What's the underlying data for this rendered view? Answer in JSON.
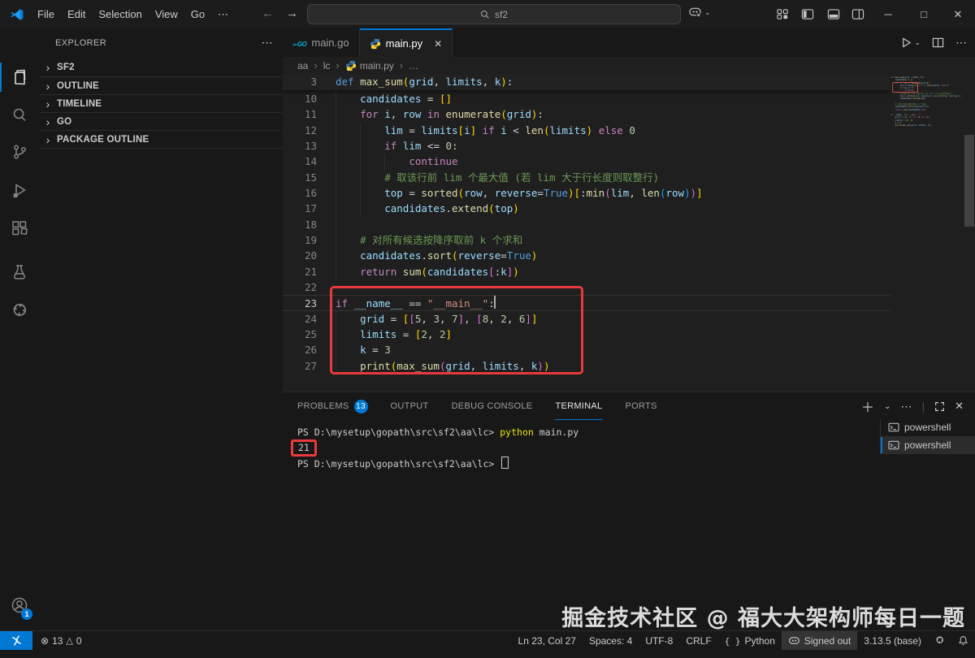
{
  "titlebar": {
    "menus": [
      "File",
      "Edit",
      "Selection",
      "View",
      "Go",
      "⋯"
    ],
    "search_value": "sf2"
  },
  "activity_bar": {
    "items": [
      {
        "name": "explorer",
        "active": true
      },
      {
        "name": "search",
        "active": false
      },
      {
        "name": "source-control",
        "active": false
      },
      {
        "name": "run-debug",
        "active": false
      },
      {
        "name": "extensions",
        "active": false
      },
      {
        "name": "testing",
        "active": false
      },
      {
        "name": "extension-custom",
        "active": false
      }
    ],
    "account_badge": "1"
  },
  "sidebar": {
    "title": "EXPLORER",
    "sections": [
      {
        "label": "SF2"
      },
      {
        "label": "OUTLINE"
      },
      {
        "label": "TIMELINE"
      },
      {
        "label": "GO"
      },
      {
        "label": "PACKAGE OUTLINE"
      }
    ]
  },
  "editor": {
    "tabs": [
      {
        "label": "main.go",
        "icon": "go",
        "active": false
      },
      {
        "label": "main.py",
        "icon": "python",
        "active": true
      }
    ],
    "breadcrumb": [
      {
        "label": "aa"
      },
      {
        "label": "lc"
      },
      {
        "label": "main.py",
        "icon": "python"
      },
      {
        "label": "…"
      }
    ],
    "sticky_line": {
      "number": "3",
      "segments": [
        [
          "def",
          "def"
        ],
        [
          " ",
          "p"
        ],
        [
          "max_sum",
          "fn"
        ],
        [
          "(",
          "b1"
        ],
        [
          "grid",
          "v"
        ],
        [
          ", ",
          "p"
        ],
        [
          "limits",
          "v"
        ],
        [
          ", ",
          "p"
        ],
        [
          "k",
          "v"
        ],
        [
          ")",
          "b1"
        ],
        [
          ":",
          "p"
        ]
      ]
    },
    "lines": [
      {
        "number": "10",
        "guides": [
          0
        ],
        "segments": [
          [
            "    ",
            "p"
          ],
          [
            "candidates",
            "v"
          ],
          [
            " = ",
            "p"
          ],
          [
            "[]",
            "b1"
          ]
        ]
      },
      {
        "number": "11",
        "guides": [
          0
        ],
        "segments": [
          [
            "    ",
            "p"
          ],
          [
            "for",
            "kw"
          ],
          [
            " ",
            "p"
          ],
          [
            "i",
            "v"
          ],
          [
            ", ",
            "p"
          ],
          [
            "row",
            "v"
          ],
          [
            " ",
            "p"
          ],
          [
            "in",
            "kw"
          ],
          [
            " ",
            "p"
          ],
          [
            "enumerate",
            "fn"
          ],
          [
            "(",
            "b1"
          ],
          [
            "grid",
            "v"
          ],
          [
            ")",
            "b1"
          ],
          [
            ":",
            "p"
          ]
        ]
      },
      {
        "number": "12",
        "guides": [
          0,
          4
        ],
        "segments": [
          [
            "        ",
            "p"
          ],
          [
            "lim",
            "v"
          ],
          [
            " = ",
            "p"
          ],
          [
            "limits",
            "v"
          ],
          [
            "[",
            "b1"
          ],
          [
            "i",
            "v"
          ],
          [
            "]",
            "b1"
          ],
          [
            " ",
            "p"
          ],
          [
            "if",
            "kw"
          ],
          [
            " ",
            "p"
          ],
          [
            "i",
            "v"
          ],
          [
            " < ",
            "p"
          ],
          [
            "len",
            "fn"
          ],
          [
            "(",
            "b1"
          ],
          [
            "limits",
            "v"
          ],
          [
            ")",
            "b1"
          ],
          [
            " ",
            "p"
          ],
          [
            "else",
            "kw"
          ],
          [
            " ",
            "p"
          ],
          [
            "0",
            "n"
          ]
        ]
      },
      {
        "number": "13",
        "guides": [
          0,
          4
        ],
        "segments": [
          [
            "        ",
            "p"
          ],
          [
            "if",
            "kw"
          ],
          [
            " ",
            "p"
          ],
          [
            "lim",
            "v"
          ],
          [
            " <= ",
            "p"
          ],
          [
            "0",
            "n"
          ],
          [
            ":",
            "p"
          ]
        ]
      },
      {
        "number": "14",
        "guides": [
          0,
          4,
          8
        ],
        "segments": [
          [
            "            ",
            "p"
          ],
          [
            "continue",
            "kw"
          ]
        ]
      },
      {
        "number": "15",
        "guides": [
          0,
          4
        ],
        "segments": [
          [
            "        ",
            "p"
          ],
          [
            "# 取该行前 lim 个最大值 (若 lim 大于行长度则取整行)",
            "c"
          ]
        ]
      },
      {
        "number": "16",
        "guides": [
          0,
          4
        ],
        "segments": [
          [
            "        ",
            "p"
          ],
          [
            "top",
            "v"
          ],
          [
            " = ",
            "p"
          ],
          [
            "sorted",
            "fn"
          ],
          [
            "(",
            "b1"
          ],
          [
            "row",
            "v"
          ],
          [
            ", ",
            "p"
          ],
          [
            "reverse",
            "v"
          ],
          [
            "=",
            "p"
          ],
          [
            "True",
            "def"
          ],
          [
            ")",
            "b1"
          ],
          [
            "[",
            "b1"
          ],
          [
            ":",
            "p"
          ],
          [
            "min",
            "fn"
          ],
          [
            "(",
            "b2"
          ],
          [
            "lim",
            "v"
          ],
          [
            ", ",
            "p"
          ],
          [
            "len",
            "fn"
          ],
          [
            "(",
            "b3"
          ],
          [
            "row",
            "v"
          ],
          [
            ")",
            "b3"
          ],
          [
            ")",
            "b2"
          ],
          [
            "]",
            "b1"
          ]
        ]
      },
      {
        "number": "17",
        "guides": [
          0,
          4
        ],
        "segments": [
          [
            "        ",
            "p"
          ],
          [
            "candidates",
            "v"
          ],
          [
            ".",
            "p"
          ],
          [
            "extend",
            "fn"
          ],
          [
            "(",
            "b1"
          ],
          [
            "top",
            "v"
          ],
          [
            ")",
            "b1"
          ]
        ]
      },
      {
        "number": "18",
        "guides": [
          0
        ],
        "segments": []
      },
      {
        "number": "19",
        "guides": [
          0
        ],
        "segments": [
          [
            "    ",
            "p"
          ],
          [
            "# 对所有候选按降序取前 k 个求和",
            "c"
          ]
        ]
      },
      {
        "number": "20",
        "guides": [
          0
        ],
        "segments": [
          [
            "    ",
            "p"
          ],
          [
            "candidates",
            "v"
          ],
          [
            ".",
            "p"
          ],
          [
            "sort",
            "fn"
          ],
          [
            "(",
            "b1"
          ],
          [
            "reverse",
            "v"
          ],
          [
            "=",
            "p"
          ],
          [
            "True",
            "def"
          ],
          [
            ")",
            "b1"
          ]
        ]
      },
      {
        "number": "21",
        "guides": [
          0
        ],
        "segments": [
          [
            "    ",
            "p"
          ],
          [
            "return",
            "kw"
          ],
          [
            " ",
            "p"
          ],
          [
            "sum",
            "fn"
          ],
          [
            "(",
            "b1"
          ],
          [
            "candidates",
            "v"
          ],
          [
            "[",
            "b2"
          ],
          [
            ":",
            "p"
          ],
          [
            "k",
            "v"
          ],
          [
            "]",
            "b2"
          ],
          [
            ")",
            "b1"
          ]
        ]
      },
      {
        "number": "22",
        "guides": [],
        "segments": []
      },
      {
        "number": "23",
        "guides": [],
        "current": true,
        "segments": [
          [
            "if",
            "kw"
          ],
          [
            " ",
            "p"
          ],
          [
            "__name__",
            "v"
          ],
          [
            " == ",
            "p"
          ],
          [
            "\"__main__\"",
            "s"
          ],
          [
            ":",
            "p"
          ]
        ]
      },
      {
        "number": "24",
        "guides": [
          0
        ],
        "segments": [
          [
            "    ",
            "p"
          ],
          [
            "grid",
            "v"
          ],
          [
            " = ",
            "p"
          ],
          [
            "[",
            "b1"
          ],
          [
            "[",
            "b2"
          ],
          [
            "5",
            "n"
          ],
          [
            ", ",
            "p"
          ],
          [
            "3",
            "n"
          ],
          [
            ", ",
            "p"
          ],
          [
            "7",
            "n"
          ],
          [
            "]",
            "b2"
          ],
          [
            ", ",
            "p"
          ],
          [
            "[",
            "b2"
          ],
          [
            "8",
            "n"
          ],
          [
            ", ",
            "p"
          ],
          [
            "2",
            "n"
          ],
          [
            ", ",
            "p"
          ],
          [
            "6",
            "n"
          ],
          [
            "]",
            "b2"
          ],
          [
            "]",
            "b1"
          ]
        ]
      },
      {
        "number": "25",
        "guides": [
          0
        ],
        "segments": [
          [
            "    ",
            "p"
          ],
          [
            "limits",
            "v"
          ],
          [
            " = ",
            "p"
          ],
          [
            "[",
            "b1"
          ],
          [
            "2",
            "n"
          ],
          [
            ", ",
            "p"
          ],
          [
            "2",
            "n"
          ],
          [
            "]",
            "b1"
          ]
        ]
      },
      {
        "number": "26",
        "guides": [
          0
        ],
        "segments": [
          [
            "    ",
            "p"
          ],
          [
            "k",
            "v"
          ],
          [
            " = ",
            "p"
          ],
          [
            "3",
            "n"
          ]
        ]
      },
      {
        "number": "27",
        "guides": [
          0
        ],
        "segments": [
          [
            "    ",
            "p"
          ],
          [
            "print",
            "fn"
          ],
          [
            "(",
            "b1"
          ],
          [
            "max_sum",
            "fn"
          ],
          [
            "(",
            "b2"
          ],
          [
            "grid",
            "v"
          ],
          [
            ", ",
            "p"
          ],
          [
            "limits",
            "v"
          ],
          [
            ", ",
            "p"
          ],
          [
            "k",
            "v"
          ],
          [
            ")",
            "b2"
          ],
          [
            ")",
            "b1"
          ]
        ]
      }
    ]
  },
  "panel": {
    "tabs": [
      {
        "label": "PROBLEMS",
        "badge": "13",
        "active": false
      },
      {
        "label": "OUTPUT",
        "active": false
      },
      {
        "label": "DEBUG CONSOLE",
        "active": false
      },
      {
        "label": "TERMINAL",
        "active": true
      },
      {
        "label": "PORTS",
        "active": false
      }
    ],
    "terminal_lines": [
      {
        "segments": [
          [
            "PS D:\\mysetup\\gopath\\src\\sf2\\aa\\lc> ",
            "pln"
          ],
          [
            "python",
            "cmd"
          ],
          [
            " main.py",
            "pln"
          ]
        ]
      },
      {
        "segments": [
          [
            "21",
            "pln"
          ]
        ],
        "boxed": true
      },
      {
        "segments": [
          [
            "PS D:\\mysetup\\gopath\\src\\sf2\\aa\\lc> ",
            "pln"
          ]
        ],
        "cursor": true
      }
    ],
    "terminal_list": [
      {
        "label": "powershell",
        "selected": false
      },
      {
        "label": "powershell",
        "selected": true
      }
    ]
  },
  "status_bar": {
    "errors": "13",
    "warnings": "0",
    "right": [
      {
        "label": "Ln 23, Col 27"
      },
      {
        "label": "Spaces: 4"
      },
      {
        "label": "UTF-8"
      },
      {
        "label": "CRLF"
      },
      {
        "label": "Python",
        "icon": "braces"
      },
      {
        "label": "Signed out",
        "icon": "copilot",
        "highlight": true
      },
      {
        "label": "3.13.5 (base)"
      },
      {
        "label": "",
        "icon": "ext"
      },
      {
        "label": "",
        "icon": "bell"
      }
    ]
  },
  "watermark": "掘金技术社区 @ 福大大架构师每日一题"
}
